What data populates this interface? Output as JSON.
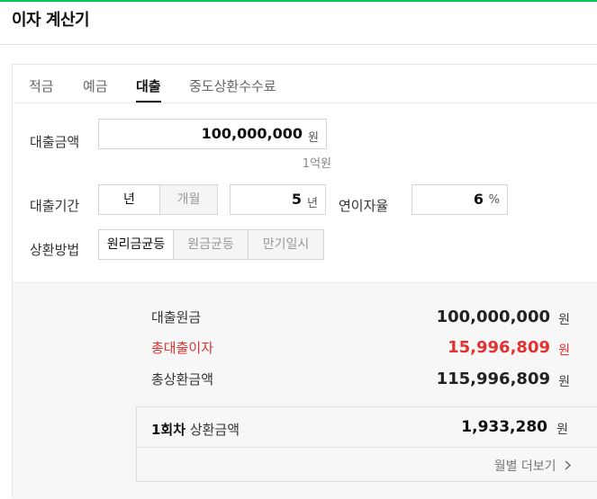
{
  "header": {
    "title": "이자 계산기"
  },
  "tabs": [
    {
      "label": "적금"
    },
    {
      "label": "예금"
    },
    {
      "label": "대출"
    },
    {
      "label": "중도상환수수료"
    }
  ],
  "loan_amount": {
    "label": "대출금액",
    "value": "100,000,000",
    "unit": "원",
    "hint": "1억원"
  },
  "loan_period": {
    "label": "대출기간",
    "unit_year": "년",
    "unit_month": "개월",
    "value": "5",
    "value_unit": "년"
  },
  "interest_rate": {
    "label": "연이자율",
    "value": "6",
    "unit": "%"
  },
  "repayment": {
    "label": "상환방법",
    "options": [
      "원리금균등",
      "원금균등",
      "만기일시"
    ]
  },
  "results": {
    "principal": {
      "label": "대출원금",
      "value": "100,000,000",
      "unit": "원"
    },
    "interest": {
      "label": "총대출이자",
      "value": "15,996,809",
      "unit": "원"
    },
    "total": {
      "label": "총상환금액",
      "value": "115,996,809",
      "unit": "원"
    }
  },
  "installment": {
    "label_bold": "1회차",
    "label_rest": " 상환금액",
    "value": "1,933,280",
    "unit": "원",
    "more_label": "월별 더보기"
  },
  "colors": {
    "accent_green": "#03c75a",
    "red": "#e4312f"
  }
}
